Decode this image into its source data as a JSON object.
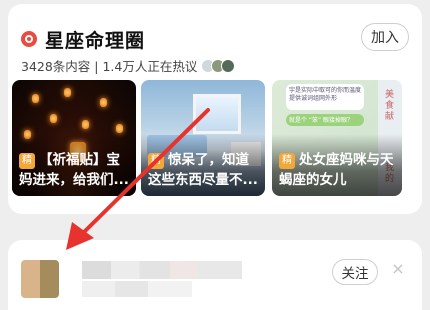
{
  "circle": {
    "title": "星座命理圈",
    "join_label": "加入",
    "stats_text": "3428条内容 | 1.4万人正在热议"
  },
  "posts": [
    {
      "tag": "精",
      "caption": "【祈福贴】宝妈进来，给我们..."
    },
    {
      "tag": "精",
      "caption": "惊呆了，知道这些东西尽量不..."
    },
    {
      "tag": "精",
      "caption": "处女座妈咪与天蝎座的女儿"
    }
  ],
  "thumb_texts": {
    "side_strip": "美食献",
    "side_strip_2": "我的",
    "chat_1": "宇是实际中取可的你而温度提供诚词组网外形",
    "chat_2": "就是个 “笨” 眼接掉眼？"
  },
  "feed": {
    "follow_label": "关注"
  },
  "colors": {
    "brand_red": "#ea4b3f",
    "tag_orange": "#f2a73a",
    "annotation_arrow": "#e8322d"
  }
}
